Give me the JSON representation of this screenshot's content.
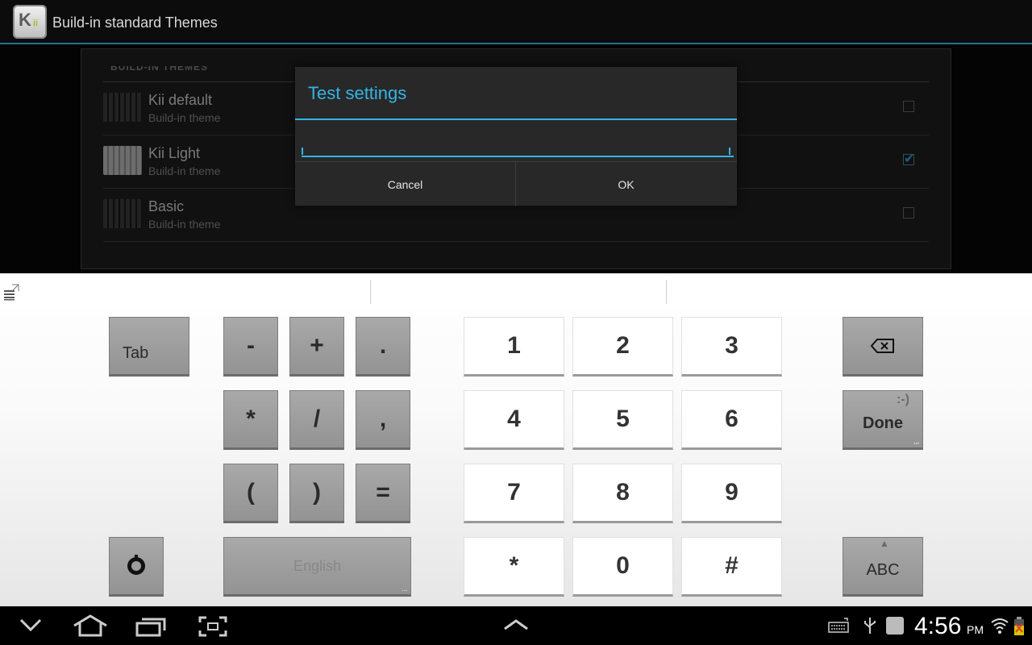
{
  "app": {
    "title": "Build-in standard Themes",
    "icon_text": "K",
    "icon_sub": "ii"
  },
  "list": {
    "section_header": "BUILD-IN THEMES",
    "items": [
      {
        "title": "Kii default",
        "subtitle": "Build-in theme",
        "checked": false,
        "icon": "dark-keyboard-thumbnail"
      },
      {
        "title": "Kii Light",
        "subtitle": "Build-in theme",
        "checked": true,
        "icon": "light-keyboard-thumbnail"
      },
      {
        "title": "Basic",
        "subtitle": "Build-in theme",
        "checked": false,
        "icon": "dark-keyboard-thumbnail"
      }
    ]
  },
  "dialog": {
    "title": "Test settings",
    "input_value": "",
    "cancel_label": "Cancel",
    "ok_label": "OK"
  },
  "keyboard": {
    "tab_label": "Tab",
    "symbols": [
      "-",
      "+",
      ".",
      "*",
      "/",
      ",",
      "(",
      ")",
      "="
    ],
    "digits": [
      "1",
      "2",
      "3",
      "4",
      "5",
      "6",
      "7",
      "8",
      "9",
      "*",
      "0",
      "#"
    ],
    "done_label": "Done",
    "done_hint": ":-)",
    "abc_label": "ABC",
    "space_label": "English",
    "icons": [
      "backspace-icon",
      "settings-icon",
      "keyboard-menu-icon"
    ]
  },
  "status": {
    "time": "4:56",
    "ampm": "PM"
  },
  "colors": {
    "accent": "#33b5e5",
    "key_gray": "#9e9e9e",
    "key_white": "#ffffff"
  }
}
